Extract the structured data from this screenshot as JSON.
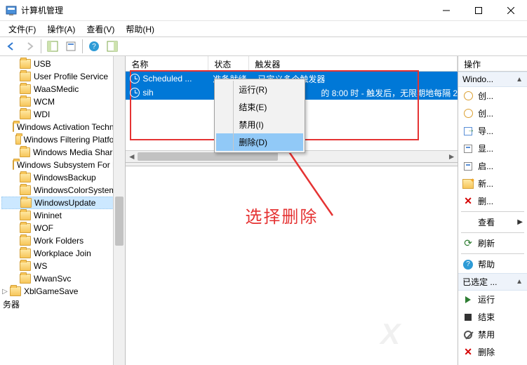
{
  "window": {
    "title": "计算机管理"
  },
  "menu": {
    "file": "文件(F)",
    "action": "操作(A)",
    "view": "查看(V)",
    "help": "帮助(H)"
  },
  "tree": {
    "items": [
      "USB",
      "User Profile Service",
      "WaaSMedic",
      "WCM",
      "WDI",
      "Windows Activation Technologies",
      "Windows Filtering Platform",
      "Windows Media Sharing",
      "Windows Subsystem For Linux",
      "WindowsBackup",
      "WindowsColorSystem",
      "WindowsUpdate",
      "Wininet",
      "WOF",
      "Work Folders",
      "Workplace Join",
      "WS",
      "WwanSvc"
    ],
    "below": "XblGameSave",
    "category": "务器",
    "selected_index": 11
  },
  "list": {
    "cols": {
      "name": "名称",
      "status": "状态",
      "trigger": "触发器"
    },
    "rows": [
      {
        "name": "Scheduled ...",
        "status": "准备就绪",
        "trigger": "已定义多个触发器"
      },
      {
        "name": "sih",
        "status": "",
        "trigger": "的 8:00 时 - 触发后，无限期地每隔 2"
      }
    ]
  },
  "context_menu": {
    "run": "运行(R)",
    "end": "结束(E)",
    "disable": "禁用(I)",
    "delete": "删除(D)"
  },
  "annotation": {
    "text": "选择删除"
  },
  "actions_pane": {
    "header": "操作",
    "section1": "Windo...",
    "create_basic": "创...",
    "create": "创...",
    "import": "导...",
    "show_running": "显...",
    "enable_history": "启...",
    "new_folder": "新...",
    "delete_folder": "删...",
    "view": "查看",
    "refresh": "刷新",
    "help": "帮助",
    "section2": "已选定 ...",
    "run": "运行",
    "end": "结束",
    "disable": "禁用",
    "delete2": "删除"
  }
}
